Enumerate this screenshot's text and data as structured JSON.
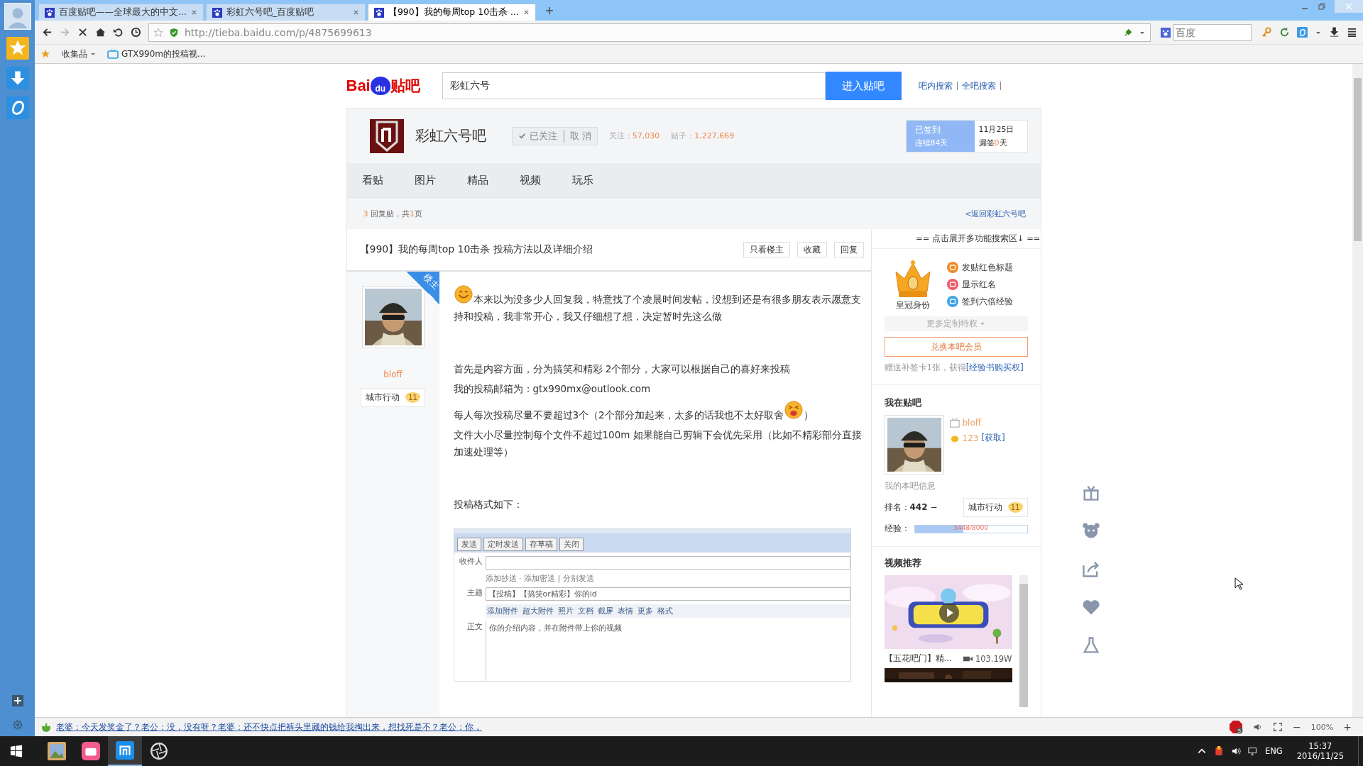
{
  "browser": {
    "tabs": [
      {
        "title": "百度贴吧——全球最大的中文...",
        "selected": false
      },
      {
        "title": "彩虹六号吧_百度贴吧",
        "selected": false
      },
      {
        "title": "【990】我的每周top 10击杀 ...",
        "selected": true
      }
    ],
    "address": "http://tieba.baidu.com/p/4875699613",
    "search_placeholder": "百度",
    "bookmarks": [
      "收集品",
      "GTX990m的投稿视..."
    ]
  },
  "header": {
    "logo": [
      "Bai",
      "du",
      "贴吧"
    ],
    "search_value": "彩虹六号",
    "search_button": "进入贴吧",
    "links": [
      "吧内搜索",
      "全吧搜索"
    ]
  },
  "forum": {
    "name": "彩虹六号吧",
    "follow": "已关注",
    "cancel": "取 消",
    "followers_label": "关注：",
    "followers": "57,030",
    "posts_label": "贴子：",
    "posts": "1,227,669",
    "signed": true,
    "sign_label": "已签到",
    "streak": "连续84天",
    "date": "11月25日",
    "missed_label": "漏签",
    "missed": "0",
    "missed_unit": "天"
  },
  "nav": [
    "看贴",
    "图片",
    "精品",
    "视频",
    "玩乐"
  ],
  "thread_info": {
    "count": "3",
    "text1": "回复贴，共",
    "pages": "1",
    "text2": "页",
    "back_link": "<返回彩虹六号吧"
  },
  "post": {
    "title": "【990】我的每周top 10击杀 投稿方法以及详细介绍",
    "buttons": [
      "只看楼主",
      "收藏",
      "回复"
    ],
    "author": {
      "name": "bloff",
      "badge": "楼主",
      "level_name": "城市行动",
      "level": "11"
    },
    "sections": [
      [
        [
          {
            "kind": "smiley"
          },
          {
            "kind": "text",
            "text": "本来以为没多少人回复我，特意找了个凌晨时间发帖，没想到还是有很多朋友表示愿意支持和投稿，我非常开心，我又仔细想了想，决定暂时先这么做"
          }
        ]
      ],
      [
        [
          {
            "kind": "text",
            "text": "首先是内容方面，分为搞笑和精彩 2个部分，大家可以根据自己的喜好来投稿"
          }
        ],
        [
          {
            "kind": "text",
            "text": "我的投稿邮箱为：gtx990mx@outlook.com"
          }
        ],
        [
          {
            "kind": "text",
            "text": "每人每次投稿尽量不要超过3个（2个部分加起来，太多的话我也不太好取舍"
          },
          {
            "kind": "grinning"
          },
          {
            "kind": "text",
            "text": "）"
          }
        ],
        [
          {
            "kind": "text",
            "text": "文件大小尽量控制每个文件不超过100m 如果能自己剪辑下会优先采用（比如不精彩部分直接加速处理等）"
          }
        ]
      ],
      [
        [
          {
            "kind": "text",
            "text": "投稿格式如下："
          }
        ]
      ]
    ],
    "compose": {
      "buttons": [
        "发送",
        "定时发送",
        "存草稿",
        "关闭"
      ],
      "to_label": "收件人",
      "cc_links": "添加抄送 · 添加密送 | 分别发送",
      "subject_label": "主题",
      "subject": "【投稿】【搞笑or精彩】你的id",
      "tools": [
        "添加附件",
        "超大附件",
        "照片",
        "文档",
        "截屏",
        "表情",
        "更多",
        "格式"
      ],
      "body_label": "正文",
      "body": "你的介绍内容，并在附件带上你的视频"
    }
  },
  "sidebar": {
    "expand": "== 点击展开多功能搜索区↓ ==",
    "crown_label": "皇冠身份",
    "perks": [
      {
        "label": "发贴红色标题",
        "color": "#f08a24"
      },
      {
        "label": "显示红名",
        "color": "#ef5a6b"
      },
      {
        "label": "签到六倍经验",
        "color": "#3ea3e8"
      }
    ],
    "more": "更多定制特权",
    "exchange_button": "兑换本吧会员",
    "gift_text": "赠送补签卡1张，获得",
    "gift_link": "[经验书购买权]",
    "me_title": "我在贴吧",
    "user": "bloff",
    "coins": "123",
    "coins_link": "[获取]",
    "info_label": "我的本吧信息",
    "rank_label": "排名：",
    "rank": "442",
    "rank_change": "−",
    "level_name": "城市行动",
    "level": "11",
    "exp_label": "经验：",
    "exp": {
      "level": 0.431,
      "text": "3448/8000"
    },
    "video_title": "视频推荐",
    "video": {
      "caption": "【五花吧门】精...",
      "views": "103.19W"
    }
  },
  "status": {
    "ticker": "老婆：今天发奖金了？老公：没，没有呀？老婆：还不快点把裤头里藏的钱给我掏出来，想找死是不？老公：你，",
    "abp_count": "5",
    "minus": "−",
    "zoom": "100%",
    "plus": "+"
  },
  "taskbar": {
    "lang": "ENG",
    "time": "15:37",
    "date": "2016/11/25"
  }
}
